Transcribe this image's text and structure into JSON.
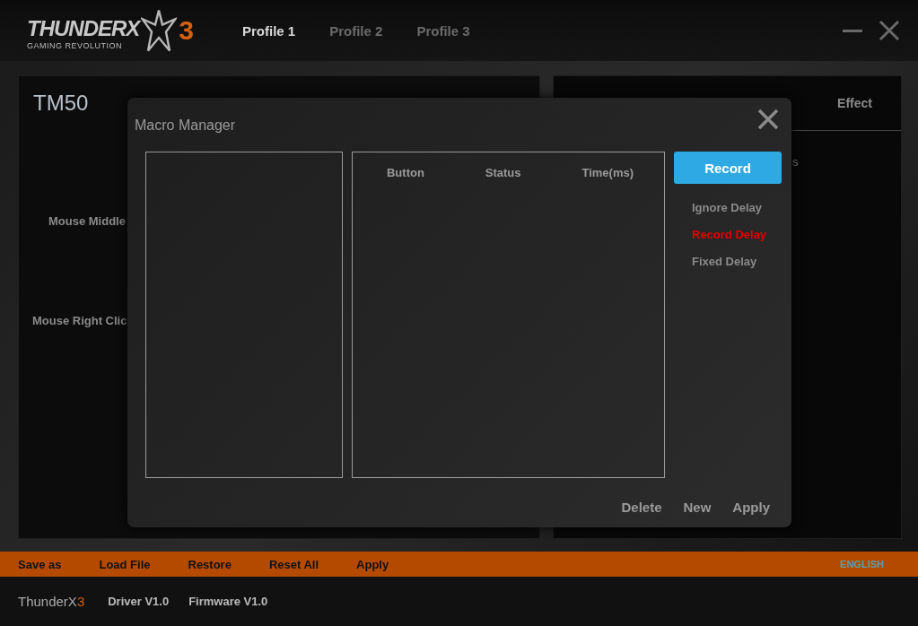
{
  "logo": {
    "name": "THUNDERX",
    "mark": "3",
    "tagline": "GAMING REVOLUTION"
  },
  "profiles": [
    {
      "label": "Profile 1",
      "selected": true
    },
    {
      "label": "Profile 2",
      "selected": false
    },
    {
      "label": "Profile 3",
      "selected": false
    }
  ],
  "device": {
    "title": "TM50",
    "buttons": [
      "Mouse Middle",
      "Mouse Right Clic"
    ]
  },
  "right_panel": {
    "tab": "Effect",
    "column_1": "s"
  },
  "dialog": {
    "title": "Macro Manager",
    "columns": [
      "Button",
      "Status",
      "Time(ms)"
    ],
    "record": "Record",
    "delay_options": [
      {
        "label": "Ignore Delay",
        "selected": false
      },
      {
        "label": "Record Delay",
        "selected": true
      },
      {
        "label": "Fixed Delay",
        "selected": false
      }
    ],
    "actions": [
      "Delete",
      "New",
      "Apply"
    ]
  },
  "action_bar": {
    "items": [
      "Save as",
      "Load File",
      "Restore",
      "Reset All",
      "Apply"
    ],
    "language": "ENGLISH"
  },
  "footer": {
    "brand": "ThunderX",
    "brand_mark": "3",
    "driver": "Driver V1.0",
    "firmware": "Firmware V1.0"
  }
}
